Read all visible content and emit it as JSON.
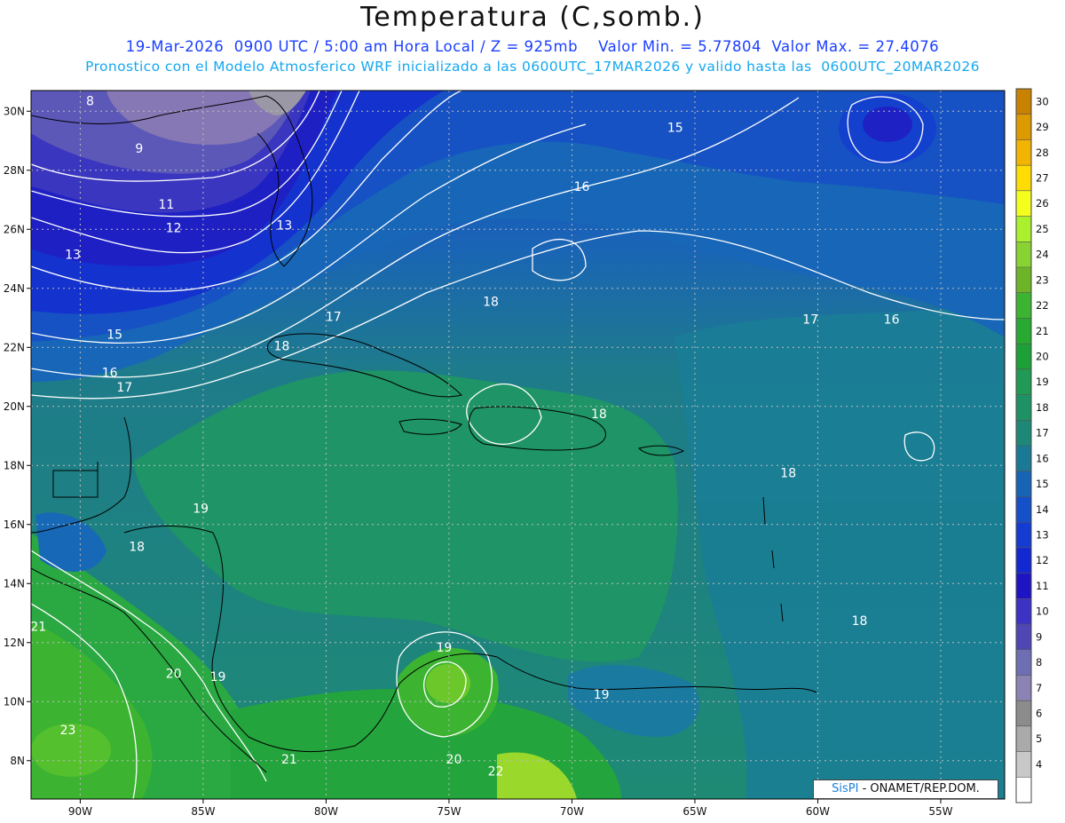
{
  "title": "Temperatura (C,somb.)",
  "subtitle1": "19-Mar-2026  0900 UTC / 5:00 am Hora Local / Z = 925mb    Valor Min. = 5.77804  Valor Max. = 27.4076",
  "subtitle2": "Pronostico con el Modelo Atmosferico WRF inicializado a las 0600UTC_17MAR2026 y valido hasta las  0600UTC_20MAR2026",
  "credit": {
    "logo": "SisPI",
    "text": "- ONAMET/REP.DOM."
  },
  "map": {
    "lon_ticks": [
      {
        "lon": -90,
        "label": "90W"
      },
      {
        "lon": -85,
        "label": "85W"
      },
      {
        "lon": -80,
        "label": "80W"
      },
      {
        "lon": -75,
        "label": "75W"
      },
      {
        "lon": -70,
        "label": "70W"
      },
      {
        "lon": -65,
        "label": "65W"
      },
      {
        "lon": -60,
        "label": "60W"
      },
      {
        "lon": -55,
        "label": "55W"
      }
    ],
    "lat_ticks": [
      {
        "lat": 30,
        "label": "30N"
      },
      {
        "lat": 28,
        "label": "28N"
      },
      {
        "lat": 26,
        "label": "26N"
      },
      {
        "lat": 24,
        "label": "24N"
      },
      {
        "lat": 22,
        "label": "22N"
      },
      {
        "lat": 20,
        "label": "20N"
      },
      {
        "lat": 18,
        "label": "18N"
      },
      {
        "lat": 16,
        "label": "16N"
      },
      {
        "lat": 14,
        "label": "14N"
      },
      {
        "lat": 12,
        "label": "12N"
      },
      {
        "lat": 10,
        "label": "10N"
      },
      {
        "lat": 8,
        "label": "8N"
      }
    ],
    "contour_labels": [
      {
        "text": "8",
        "lon": -89.6,
        "lat": 30.2
      },
      {
        "text": "9",
        "lon": -87.6,
        "lat": 28.6
      },
      {
        "text": "11",
        "lon": -86.5,
        "lat": 26.7
      },
      {
        "text": "12",
        "lon": -86.2,
        "lat": 25.9
      },
      {
        "text": "13",
        "lon": -81.7,
        "lat": 26.0
      },
      {
        "text": "13",
        "lon": -90.3,
        "lat": 25.0
      },
      {
        "text": "15",
        "lon": -88.6,
        "lat": 22.3
      },
      {
        "text": "16",
        "lon": -88.8,
        "lat": 21.0
      },
      {
        "text": "17",
        "lon": -88.2,
        "lat": 20.5
      },
      {
        "text": "18",
        "lon": -81.8,
        "lat": 21.9
      },
      {
        "text": "17",
        "lon": -79.7,
        "lat": 22.9
      },
      {
        "text": "18",
        "lon": -73.3,
        "lat": 23.4
      },
      {
        "text": "15",
        "lon": -65.8,
        "lat": 29.3
      },
      {
        "text": "16",
        "lon": -69.6,
        "lat": 27.3
      },
      {
        "text": "17",
        "lon": -60.3,
        "lat": 22.8
      },
      {
        "text": "16",
        "lon": -57.0,
        "lat": 22.8
      },
      {
        "text": "18",
        "lon": -68.9,
        "lat": 19.6
      },
      {
        "text": "18",
        "lon": -61.2,
        "lat": 17.6
      },
      {
        "text": "18",
        "lon": -58.3,
        "lat": 12.6
      },
      {
        "text": "19",
        "lon": -85.1,
        "lat": 16.4
      },
      {
        "text": "18",
        "lon": -87.7,
        "lat": 15.1
      },
      {
        "text": "21",
        "lon": -91.7,
        "lat": 12.4
      },
      {
        "text": "20",
        "lon": -86.2,
        "lat": 10.8
      },
      {
        "text": "19",
        "lon": -84.4,
        "lat": 10.7
      },
      {
        "text": "23",
        "lon": -90.5,
        "lat": 8.9
      },
      {
        "text": "21",
        "lon": -81.5,
        "lat": 7.9
      },
      {
        "text": "19",
        "lon": -75.2,
        "lat": 11.7
      },
      {
        "text": "20",
        "lon": -74.8,
        "lat": 7.9
      },
      {
        "text": "22",
        "lon": -73.1,
        "lat": 7.5
      },
      {
        "text": "19",
        "lon": -68.8,
        "lat": 10.1
      }
    ]
  },
  "colorbar": {
    "labels": [
      "30",
      "29",
      "28",
      "27",
      "26",
      "25",
      "24",
      "23",
      "22",
      "21",
      "20",
      "19",
      "18",
      "17",
      "16",
      "15",
      "14",
      "13",
      "12",
      "11",
      "10",
      "9",
      "8",
      "7",
      "6",
      "5",
      "4"
    ],
    "colors": [
      "#c88200",
      "#dc9a00",
      "#f2b400",
      "#ffdd00",
      "#f4ff1e",
      "#aaf02c",
      "#88d232",
      "#6eb428",
      "#3cb432",
      "#28aa32",
      "#1ea038",
      "#219a55",
      "#1e9264",
      "#1e8878",
      "#1a7a96",
      "#1764b4",
      "#1450c8",
      "#143cd2",
      "#1428d2",
      "#1e14c3",
      "#3c32c3",
      "#5046b4",
      "#6e6eb4",
      "#8c82b4",
      "#8c8c8c",
      "#aaaaaa",
      "#c8c8c8",
      "#ffffff"
    ]
  }
}
